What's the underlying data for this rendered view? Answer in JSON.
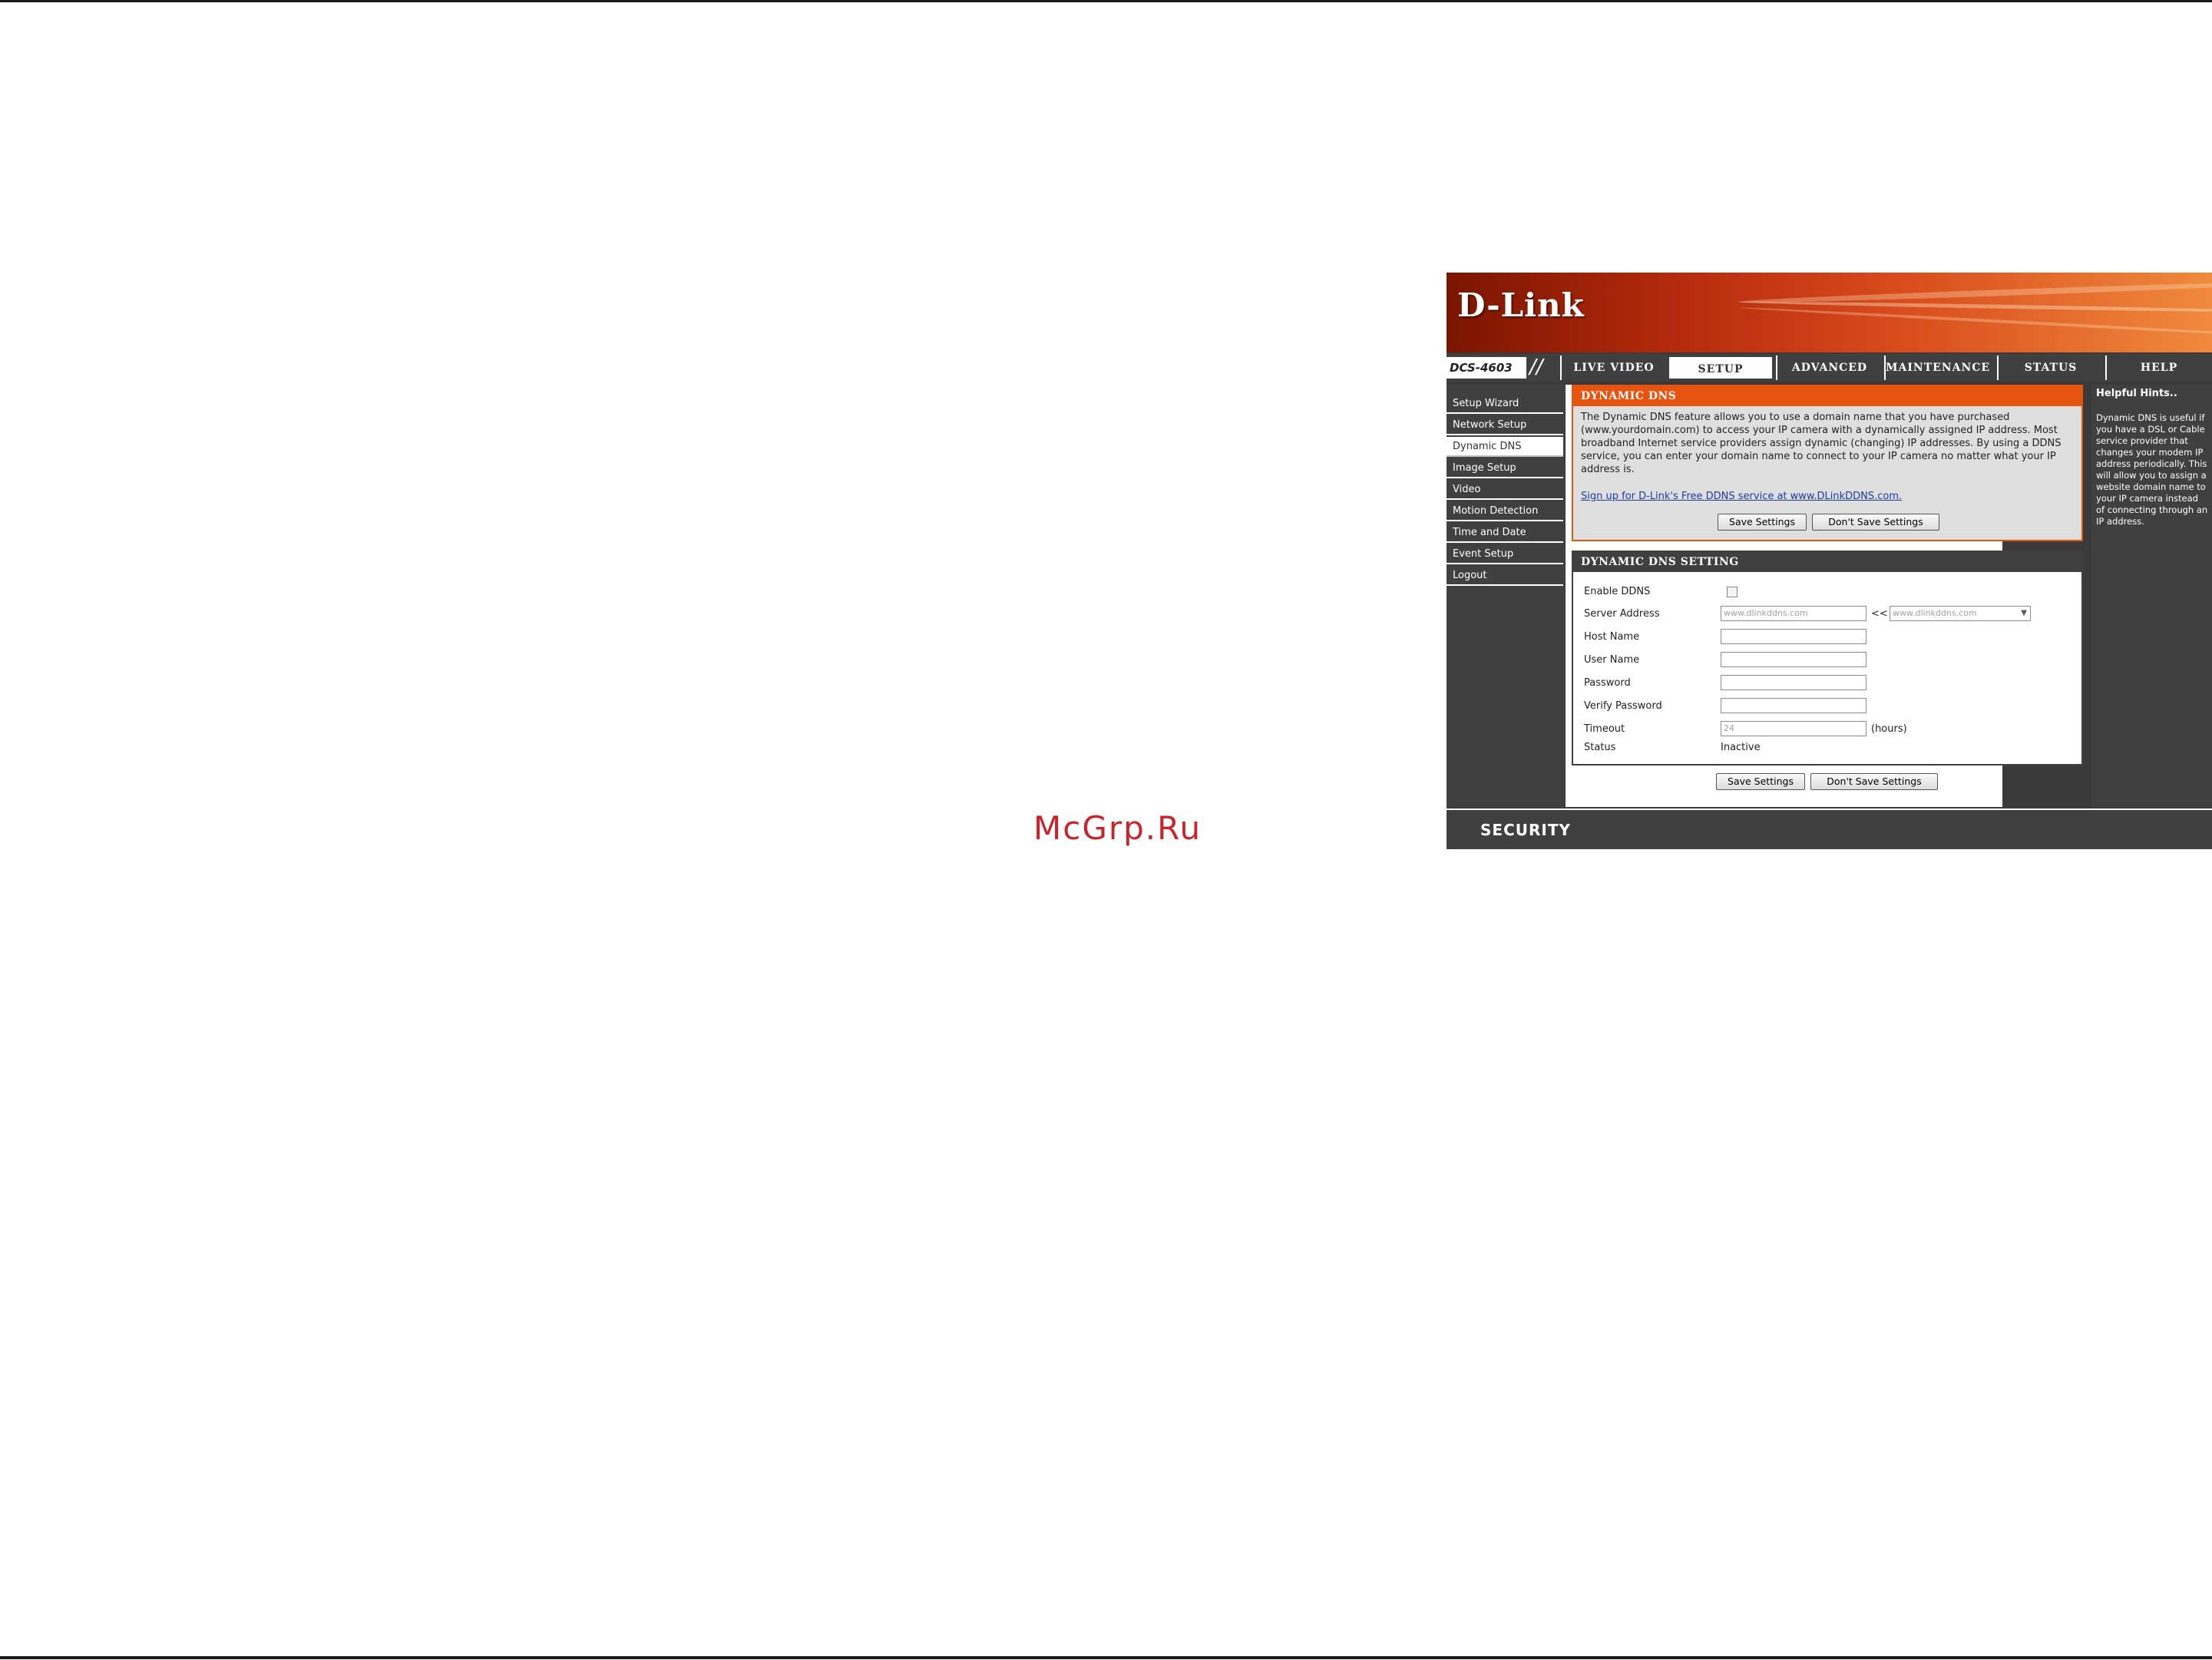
{
  "watermark": "McGrp.Ru",
  "brand": {
    "logo": "D-Link",
    "model": "DCS-4603",
    "footer": "SECURITY",
    "colors": {
      "orange": "#e65410",
      "dark": "#404040",
      "link": "#1a3d9e"
    }
  },
  "tabs": [
    {
      "label": "LIVE VIDEO"
    },
    {
      "label": "SETUP"
    },
    {
      "label": "ADVANCED"
    },
    {
      "label": "MAINTENANCE"
    },
    {
      "label": "STATUS"
    },
    {
      "label": "HELP"
    }
  ],
  "sidebar": [
    {
      "label": "Setup Wizard"
    },
    {
      "label": "Network Setup"
    },
    {
      "label": "Dynamic DNS"
    },
    {
      "label": "Image Setup"
    },
    {
      "label": "Video"
    },
    {
      "label": "Motion Detection"
    },
    {
      "label": "Time and Date"
    },
    {
      "label": "Event Setup"
    },
    {
      "label": "Logout"
    }
  ],
  "ddns": {
    "title": "DYNAMIC DNS",
    "description": "The Dynamic DNS feature allows you to use a domain name that you have purchased (www.yourdomain.com) to access your IP camera with a dynamically assigned IP address. Most broadband Internet service providers assign dynamic (changing) IP addresses. By using a DDNS service, you can enter your domain name to connect to your IP camera no matter what your IP address is.",
    "signup_link": "Sign up for D-Link's Free DDNS service at www.DLinkDDNS.com.",
    "save_label": "Save Settings",
    "dont_save_label": "Don't Save Settings"
  },
  "settings": {
    "title": "DYNAMIC DNS SETTING",
    "enable_label": "Enable DDNS",
    "server_label": "Server Address",
    "server_value": "www.dlinkddns.com",
    "arrows": "<<",
    "server_select": "www.dlinkddns.com",
    "host_label": "Host Name",
    "host_value": "",
    "user_label": "User Name",
    "user_value": "",
    "password_label": "Password",
    "password_value": "",
    "verify_label": "Verify Password",
    "verify_value": "",
    "timeout_label": "Timeout",
    "timeout_value": "24",
    "timeout_suffix": "(hours)",
    "status_label": "Status",
    "status_value": "Inactive",
    "save_label": "Save Settings",
    "dont_save_label": "Don't Save Settings"
  },
  "hints": {
    "title": "Helpful Hints..",
    "body": "Dynamic DNS is useful if you have a DSL or Cable service provider that changes your modem IP address periodically. This will allow you to assign a website domain name to your IP camera instead of connecting through an IP address."
  }
}
